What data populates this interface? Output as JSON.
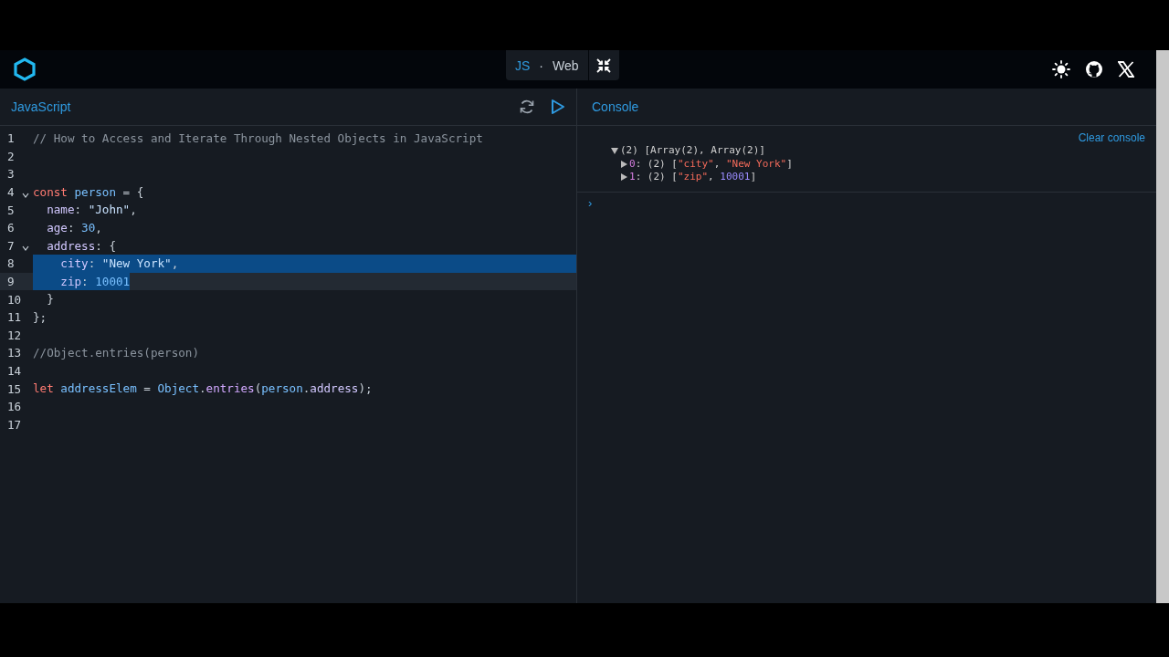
{
  "header": {
    "modes": [
      {
        "label": "JS",
        "selected": true
      },
      {
        "label": "Web",
        "selected": false
      }
    ],
    "separator": "·"
  },
  "editor": {
    "title": "JavaScript",
    "lines": [
      {
        "number": "1",
        "tokens": [
          {
            "text": "// How to Access and Iterate Through Nested Objects in JavaScript",
            "kind": "comment"
          }
        ]
      },
      {
        "number": "2"
      },
      {
        "number": "3"
      },
      {
        "number": "4",
        "foldable": true,
        "tokens": [
          {
            "text": "const",
            "kind": "kw"
          },
          {
            "text": " person",
            "kind": "var"
          },
          {
            "text": " = {",
            "kind": "punc"
          }
        ]
      },
      {
        "number": "5",
        "tokens": [
          {
            "text": "  name",
            "kind": "prop"
          },
          {
            "text": ": ",
            "kind": "punc"
          },
          {
            "text": "\"John\"",
            "kind": "str"
          },
          {
            "text": ",",
            "kind": "punc"
          }
        ]
      },
      {
        "number": "6",
        "tokens": [
          {
            "text": "  age",
            "kind": "prop"
          },
          {
            "text": ": ",
            "kind": "punc"
          },
          {
            "text": "30",
            "kind": "num"
          },
          {
            "text": ",",
            "kind": "punc"
          }
        ]
      },
      {
        "number": "7",
        "foldable": true,
        "tokens": [
          {
            "text": "  address",
            "kind": "prop"
          },
          {
            "text": ": {",
            "kind": "punc"
          }
        ]
      },
      {
        "number": "8",
        "selected": true,
        "tokens": [
          {
            "text": "    city",
            "kind": "prop"
          },
          {
            "text": ": ",
            "kind": "punc"
          },
          {
            "text": "\"New York\"",
            "kind": "str"
          },
          {
            "text": ",",
            "kind": "punc"
          }
        ]
      },
      {
        "number": "9",
        "selected": true,
        "current": true,
        "tokens": [
          {
            "text": "    zip",
            "kind": "prop"
          },
          {
            "text": ": ",
            "kind": "punc"
          },
          {
            "text": "10001",
            "kind": "num"
          }
        ]
      },
      {
        "number": "10",
        "tokens": [
          {
            "text": "  }",
            "kind": "punc"
          }
        ]
      },
      {
        "number": "11",
        "tokens": [
          {
            "text": "};",
            "kind": "punc"
          }
        ]
      },
      {
        "number": "12"
      },
      {
        "number": "13",
        "tokens": [
          {
            "text": "//Object.entries(person)",
            "kind": "comment"
          }
        ]
      },
      {
        "number": "14"
      },
      {
        "number": "15",
        "tokens": [
          {
            "text": "let",
            "kind": "kw"
          },
          {
            "text": " addressElem",
            "kind": "var"
          },
          {
            "text": " = ",
            "kind": "punc"
          },
          {
            "text": "Object",
            "kind": "var"
          },
          {
            "text": ".",
            "kind": "punc"
          },
          {
            "text": "entries",
            "kind": "fn"
          },
          {
            "text": "(",
            "kind": "punc"
          },
          {
            "text": "person",
            "kind": "var"
          },
          {
            "text": ".",
            "kind": "punc"
          },
          {
            "text": "address",
            "kind": "prop"
          },
          {
            "text": ");",
            "kind": "punc"
          }
        ]
      },
      {
        "number": "16"
      },
      {
        "number": "17"
      }
    ]
  },
  "console": {
    "title": "Console",
    "clear_label": "Clear console",
    "prompt": "›",
    "entries": [
      {
        "expanded": true,
        "tokens": [
          {
            "text": "(2) [Array(2), Array(2)]",
            "kind": "punc"
          }
        ],
        "children": [
          {
            "expanded": false,
            "tokens": [
              {
                "text": "0",
                "kind": "index"
              },
              {
                "text": ": (2) [",
                "kind": "punc"
              },
              {
                "text": "\"city\"",
                "kind": "str"
              },
              {
                "text": ", ",
                "kind": "punc"
              },
              {
                "text": "\"New York\"",
                "kind": "str"
              },
              {
                "text": "]",
                "kind": "punc"
              }
            ]
          },
          {
            "expanded": false,
            "tokens": [
              {
                "text": "1",
                "kind": "index"
              },
              {
                "text": ": (2) [",
                "kind": "punc"
              },
              {
                "text": "\"zip\"",
                "kind": "str"
              },
              {
                "text": ", ",
                "kind": "punc"
              },
              {
                "text": "10001",
                "kind": "num"
              },
              {
                "text": "]",
                "kind": "punc"
              }
            ]
          }
        ]
      }
    ]
  }
}
